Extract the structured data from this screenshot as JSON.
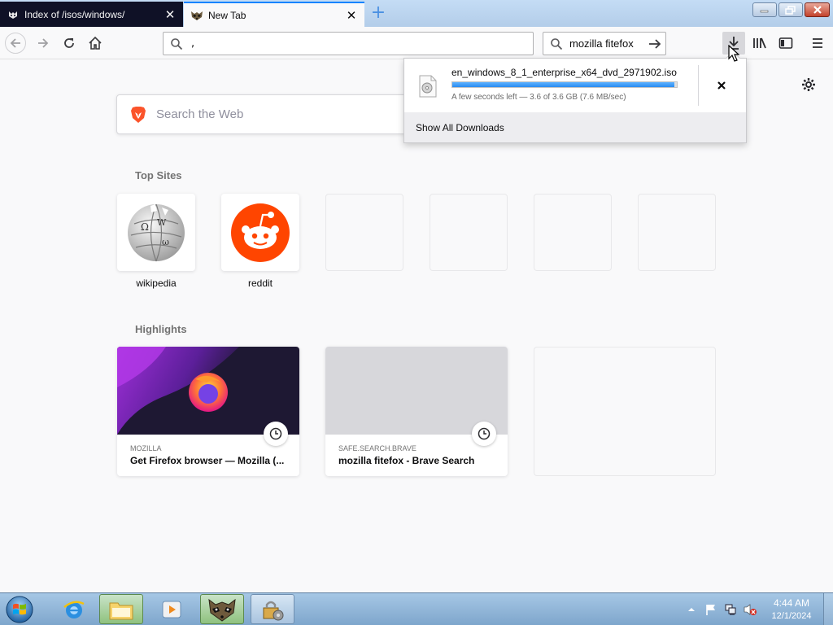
{
  "tabs": [
    {
      "label": "Index of /isos/windows/",
      "icon": "raccoon-favicon-icon",
      "active": false
    },
    {
      "label": "New Tab",
      "icon": "raccoon-favicon-icon",
      "active": true
    }
  ],
  "navbar": {
    "url_value": ",",
    "search_value": "mozilla fitefox"
  },
  "newtab": {
    "websearch_placeholder": "Search the Web",
    "top_sites_heading": "Top Sites",
    "top_sites": [
      {
        "label": "wikipedia",
        "icon": "wikipedia-globe-icon"
      },
      {
        "label": "reddit",
        "icon": "reddit-alien-icon"
      }
    ],
    "highlights_heading": "Highlights",
    "highlights": [
      {
        "source": "MOZILLA",
        "title": "Get Firefox browser — Mozilla (..."
      },
      {
        "source": "SAFE.SEARCH.BRAVE",
        "title": "mozilla fitefox - Brave Search"
      }
    ]
  },
  "downloads": {
    "filename": "en_windows_8_1_enterprise_x64_dvd_2971902.iso",
    "status": "A few seconds left — 3.6 of 3.6 GB (7.6 MB/sec)",
    "progress": 0.99,
    "show_all_label": "Show All Downloads"
  },
  "taskbar": {
    "time": "4:44 AM",
    "date": "12/1/2024"
  },
  "colors": {
    "accent": "#0a84ff",
    "reddit": "#ff4500",
    "progress": "#2a8bf0",
    "taskbar": "#7ea6cc"
  }
}
